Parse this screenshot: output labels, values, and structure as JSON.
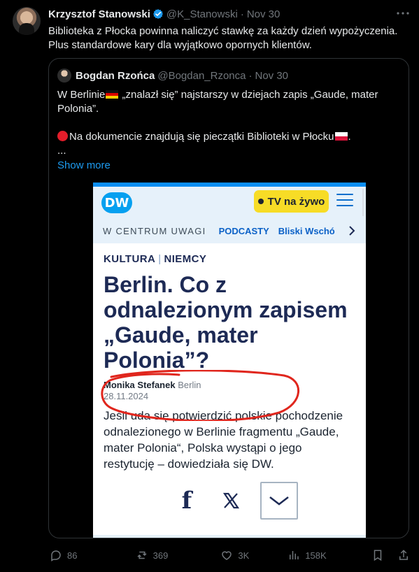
{
  "tweet": {
    "author_name": "Krzysztof Stanowski",
    "handle": "@K_Stanowski",
    "separator": "·",
    "date": "Nov 30",
    "text": "Biblioteka z Płocka powinna naliczyć stawkę za każdy dzień wypożyczenia. Plus standardowe kary dla wyjątkowo opornych klientów.",
    "icons": [
      "verified-badge-icon",
      "more-horizontal-icon"
    ],
    "colors": {
      "background": "#000000",
      "text": "#e7e9ea",
      "muted": "#71767b",
      "accent": "#1d9bf0"
    }
  },
  "quote": {
    "author_name": "Bogdan Rzońca",
    "handle": "@Bogdan_Rzonca",
    "separator": "·",
    "date": "Nov 30",
    "line1_prefix": "W Berlinie",
    "line1_suffix": " „znalazł się” najstarszy w dziejach zapis „Gaude, mater Polonia”.",
    "line2": "Na dokumencie znajdują się pieczątki Biblioteki w Płocku",
    "ellipsis": "...",
    "show_more": "Show more",
    "icons": [
      "germany-flag-icon",
      "red-circle-icon",
      "poland-flag-icon"
    ]
  },
  "embedded_screenshot": {
    "logo": "DW",
    "live_button": "TV na żywo",
    "nav": {
      "item1": "W CENTRUM UWAGI",
      "item2": "PODCASTY",
      "item3": "Bliski Wschó"
    },
    "category_1": "KULTURA",
    "category_sep": "|",
    "category_2": "NIEMCY",
    "headline": "Berlin. Co z odnalezionym zapisem „Gaude, mater Polonia”?",
    "author": "Monika Stefanek",
    "place": "Berlin",
    "date": "28.11.2024",
    "lead": "Jeśli uda się potwierdzić polskie pochodzenie odnalezionego w Berlinie fragmentu „Gaude, mater Polonia“, Polska wystąpi o jego restytucję – dowiedziała się DW.",
    "share_icons": [
      "facebook-icon",
      "x-icon",
      "chevron-down-icon"
    ],
    "colors": {
      "brand_blue": "#06a0f0",
      "headline": "#1d2a55",
      "live_yellow": "#f7dc26",
      "annotation_red": "#e0261d"
    }
  },
  "actions": {
    "replies": "86",
    "reposts": "369",
    "likes": "3K",
    "views": "158K",
    "icons": [
      "reply-icon",
      "repost-icon",
      "like-icon",
      "views-icon",
      "bookmark-icon",
      "share-icon"
    ]
  }
}
